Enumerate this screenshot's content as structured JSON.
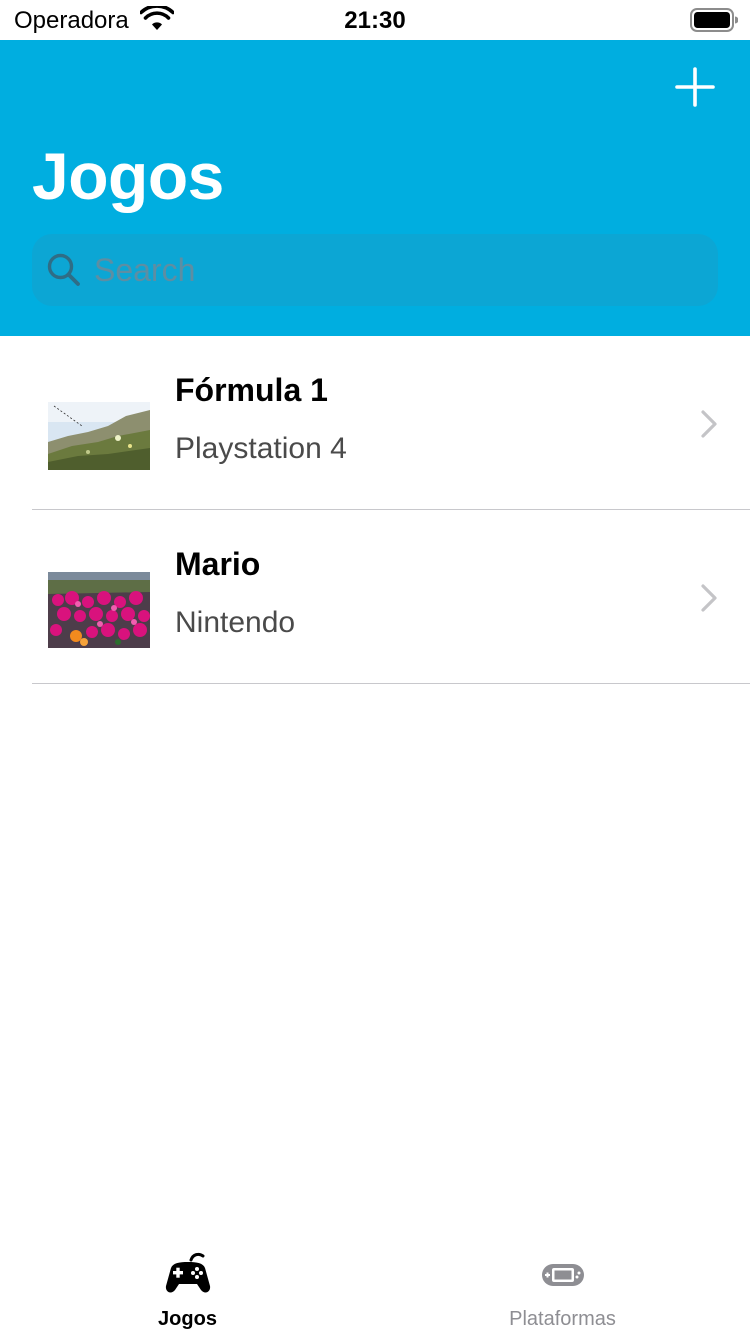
{
  "status_bar": {
    "carrier": "Operadora",
    "time": "21:30"
  },
  "nav": {
    "title": "Jogos",
    "add_icon": "plus-icon",
    "search": {
      "placeholder": "Search",
      "icon": "search-icon"
    }
  },
  "games": [
    {
      "title": "Fórmula 1",
      "platform": "Playstation 4",
      "thumbnail": "grassy-dune-photo"
    },
    {
      "title": "Mario",
      "platform": "Nintendo",
      "thumbnail": "pink-flowers-photo"
    }
  ],
  "tab_bar": {
    "tabs": [
      {
        "label": "Jogos",
        "icon": "gamepad-icon",
        "selected": true
      },
      {
        "label": "Plataformas",
        "icon": "handheld-console-icon",
        "selected": false
      }
    ]
  },
  "colors": {
    "nav_background": "#00aee0",
    "search_background": "#0ca6d4",
    "active_tab": "#000000",
    "inactive_tab": "#8e8e93"
  }
}
